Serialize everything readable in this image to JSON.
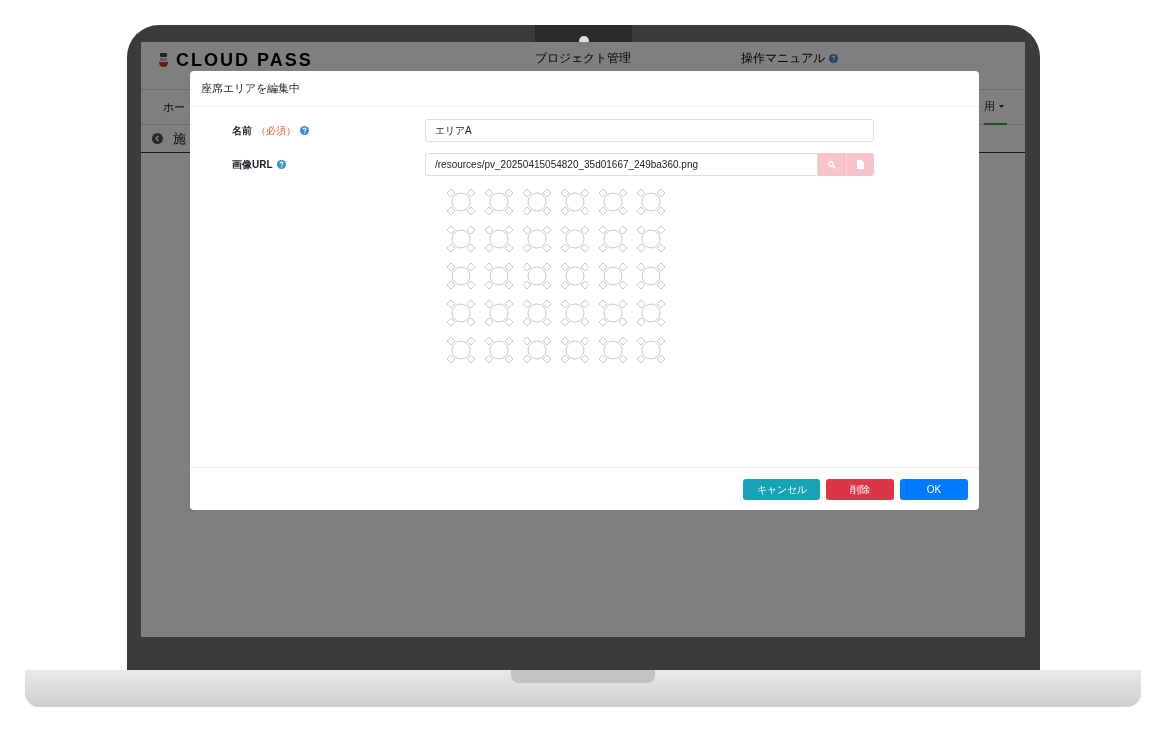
{
  "app": {
    "logo": "CLOUD PASS",
    "nav": [
      {
        "label": "プロジェクト管理",
        "help": false
      },
      {
        "label": "操作マニュアル",
        "help": true
      }
    ],
    "menu": [
      {
        "label": "ホー",
        "selected": false
      },
      {
        "label": "用",
        "selected": true
      }
    ],
    "section": "施"
  },
  "dialog": {
    "title": "座席エリアを編集中",
    "fields": [
      {
        "kind": "text",
        "label": "名前",
        "required_note": "（必須）",
        "value": "エリアA"
      },
      {
        "kind": "file",
        "label": "画像URL",
        "value": "/resources/pv_20250415054820_35d01667_249ba360.png"
      }
    ],
    "buttons": [
      {
        "kind": "info",
        "label": "キャンセル"
      },
      {
        "kind": "danger",
        "label": "削除"
      },
      {
        "kind": "primary",
        "label": "OK"
      }
    ]
  }
}
